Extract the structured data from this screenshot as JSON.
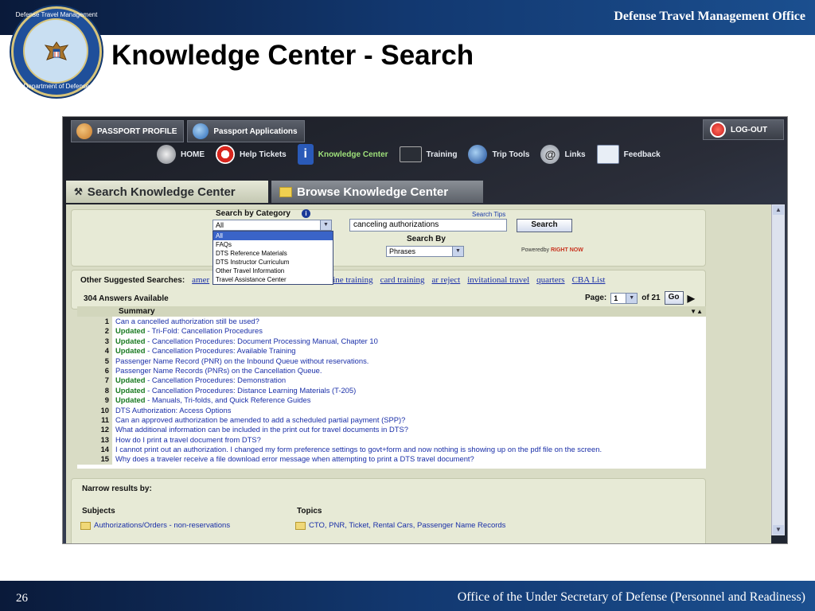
{
  "slide": {
    "org": "Defense Travel Management Office",
    "title": "Knowledge Center - Search",
    "page_number": "26",
    "footer": "Office of the Under Secretary of Defense (Personnel and Readiness)",
    "seal_top": "Defense Travel Management Office",
    "seal_bottom": "Department of Defense"
  },
  "app": {
    "nav_top": [
      {
        "label": "PASSPORT PROFILE",
        "icon": "users-icon"
      },
      {
        "label": "Passport Applications",
        "icon": "globe-icon"
      }
    ],
    "logout": "LOG-OUT",
    "nav_main": [
      {
        "label": "HOME",
        "icon": "home-icon"
      },
      {
        "label": "Help Tickets",
        "icon": "lifebuoy-icon"
      },
      {
        "label": "Knowledge Center",
        "icon": "info-icon",
        "active": true
      },
      {
        "label": "Training",
        "icon": "chalkboard-icon"
      },
      {
        "label": "Trip Tools",
        "icon": "globe-icon"
      },
      {
        "label": "Links",
        "icon": "at-sign-icon"
      },
      {
        "label": "Feedback",
        "icon": "notebook-icon"
      }
    ],
    "tabs": [
      {
        "label": "Search Knowledge Center",
        "active": true
      },
      {
        "label": "Browse Knowledge Center",
        "active": false
      }
    ],
    "search": {
      "category_label": "Search by Category",
      "category_value": "All",
      "category_options": [
        "All",
        "FAQs",
        "DTS Reference Materials",
        "DTS Instructor Curriculum",
        "Other Travel Information",
        "Travel Assistance Center"
      ],
      "query": "canceling authorizations",
      "tips": "Search Tips",
      "button": "Search",
      "search_by_label": "Search By",
      "search_by_value": "Phrases",
      "powered_by": "Poweredby",
      "powered_brand": "RIGHT NOW"
    },
    "suggested": {
      "label": "Other Suggested Searches:",
      "links": [
        "amer",
        "online training",
        "card training",
        "ar reject",
        "invitational travel",
        "quarters",
        "CBA List"
      ]
    },
    "answers": {
      "count": "304 Answers Available",
      "page_label": "Page:",
      "page_value": "1",
      "of_label": "of 21",
      "go": "Go",
      "summary_header": "Summary",
      "sort_icons": "▼▲",
      "rows": [
        {
          "n": "1",
          "tag": "",
          "text": "Can a cancelled authorization still be used?"
        },
        {
          "n": "2",
          "tag": "Updated",
          "text": " - Tri-Fold: Cancellation Procedures"
        },
        {
          "n": "3",
          "tag": "Updated",
          "text": " - Cancellation Procedures: Document Processing Manual, Chapter 10"
        },
        {
          "n": "4",
          "tag": "Updated",
          "text": " - Cancellation Procedures: Available Training"
        },
        {
          "n": "5",
          "tag": "",
          "text": "Passenger Name Record (PNR) on the Inbound Queue without reservations."
        },
        {
          "n": "6",
          "tag": "",
          "text": "Passenger Name Records (PNRs) on the Cancellation Queue."
        },
        {
          "n": "7",
          "tag": "Updated",
          "text": " - Cancellation Procedures: Demonstration"
        },
        {
          "n": "8",
          "tag": "Updated",
          "text": " - Cancellation Procedures: Distance Learning Materials (T-205)"
        },
        {
          "n": "9",
          "tag": "Updated",
          "text": " - Manuals, Tri-folds, and Quick Reference Guides"
        },
        {
          "n": "10",
          "tag": "",
          "text": "DTS Authorization: Access Options"
        },
        {
          "n": "11",
          "tag": "",
          "text": "Can an approved authorization be amended to add a scheduled partial payment (SPP)?"
        },
        {
          "n": "12",
          "tag": "",
          "text": "What additional information can be included in the print out for travel documents in DTS?"
        },
        {
          "n": "13",
          "tag": "",
          "text": "How do I print a travel document from DTS?"
        },
        {
          "n": "14",
          "tag": "",
          "text": "I cannot print out an authorization. I changed my form preference settings to govt+form and now nothing is showing up on the pdf file on the screen."
        },
        {
          "n": "15",
          "tag": "",
          "text": "Why does a traveler receive a file download error message when attempting to print a DTS travel document?"
        }
      ]
    },
    "narrow": {
      "label": "Narrow results by:",
      "subjects_label": "Subjects",
      "topics_label": "Topics",
      "subject_item": "Authorizations/Orders - non-reservations",
      "topic_item": "CTO, PNR, Ticket, Rental Cars, Passenger Name Records"
    }
  }
}
